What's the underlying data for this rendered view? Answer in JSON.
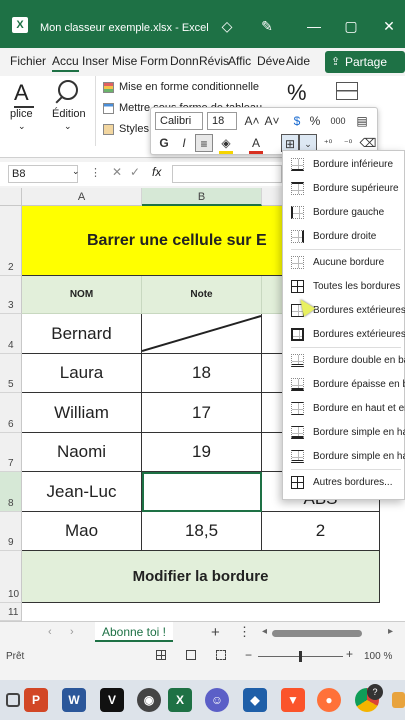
{
  "titlebar": {
    "app_icon": "X",
    "title": "Mon classeur exemple.xlsx  -  Excel"
  },
  "tabs": [
    "Fichier",
    "Accu",
    "Inser",
    "Mise",
    "Form",
    "Donn",
    "Révis",
    "Affic",
    "Déve",
    "Aide"
  ],
  "share_label": "Partage",
  "ribbon": {
    "align_label": "plice",
    "edition_label": "Édition",
    "cond_format": "Mise en forme conditionnelle",
    "table_format": "Mettre sous forme de tableau",
    "cell_styles": "Styles c",
    "percent": "%"
  },
  "mini_toolbar": {
    "font": "Calibri",
    "size": "18",
    "bold": "G",
    "italic": "I",
    "percent": "%",
    "thousands": "000"
  },
  "formula_bar": {
    "name_box": "B8",
    "fx": "fx"
  },
  "columns": [
    "A",
    "B"
  ],
  "rows": {
    "r2": "2",
    "r3": "3",
    "r4": "4",
    "r5": "5",
    "r6": "6",
    "r7": "7",
    "r8": "8",
    "r9": "9",
    "r10": "10",
    "r11": "11"
  },
  "sheet": {
    "title": "Barrer une cellule sur E",
    "h_nom": "NOM",
    "h_note": "Note",
    "r4_a": "Bernard",
    "r5_a": "Laura",
    "r5_b": "18",
    "r6_a": "William",
    "r6_b": "17",
    "r7_a": "Naomi",
    "r7_b": "19",
    "r8_a": "Jean-Luc",
    "r8_c": "ABS",
    "r9_a": "Mao",
    "r9_b": "18,5",
    "r9_c": "2",
    "footer": "Modifier la bordure"
  },
  "border_menu": [
    "Bordure inférieure",
    "Bordure supérieure",
    "Bordure gauche",
    "Bordure droite",
    "Aucune bordure",
    "Toutes les bordures",
    "Bordures extérieures",
    "Bordures extérieures",
    "Bordure double en ba",
    "Bordure épaisse en b",
    "Bordure en haut et er",
    "Bordure simple en ha",
    "Bordure simple en ha",
    "Autres bordures..."
  ],
  "sheet_tab": "Abonne toi !",
  "status": {
    "ready": "Prêt",
    "zoom": "100 %"
  },
  "taskbar": [
    "P",
    "W",
    "V",
    "X"
  ]
}
